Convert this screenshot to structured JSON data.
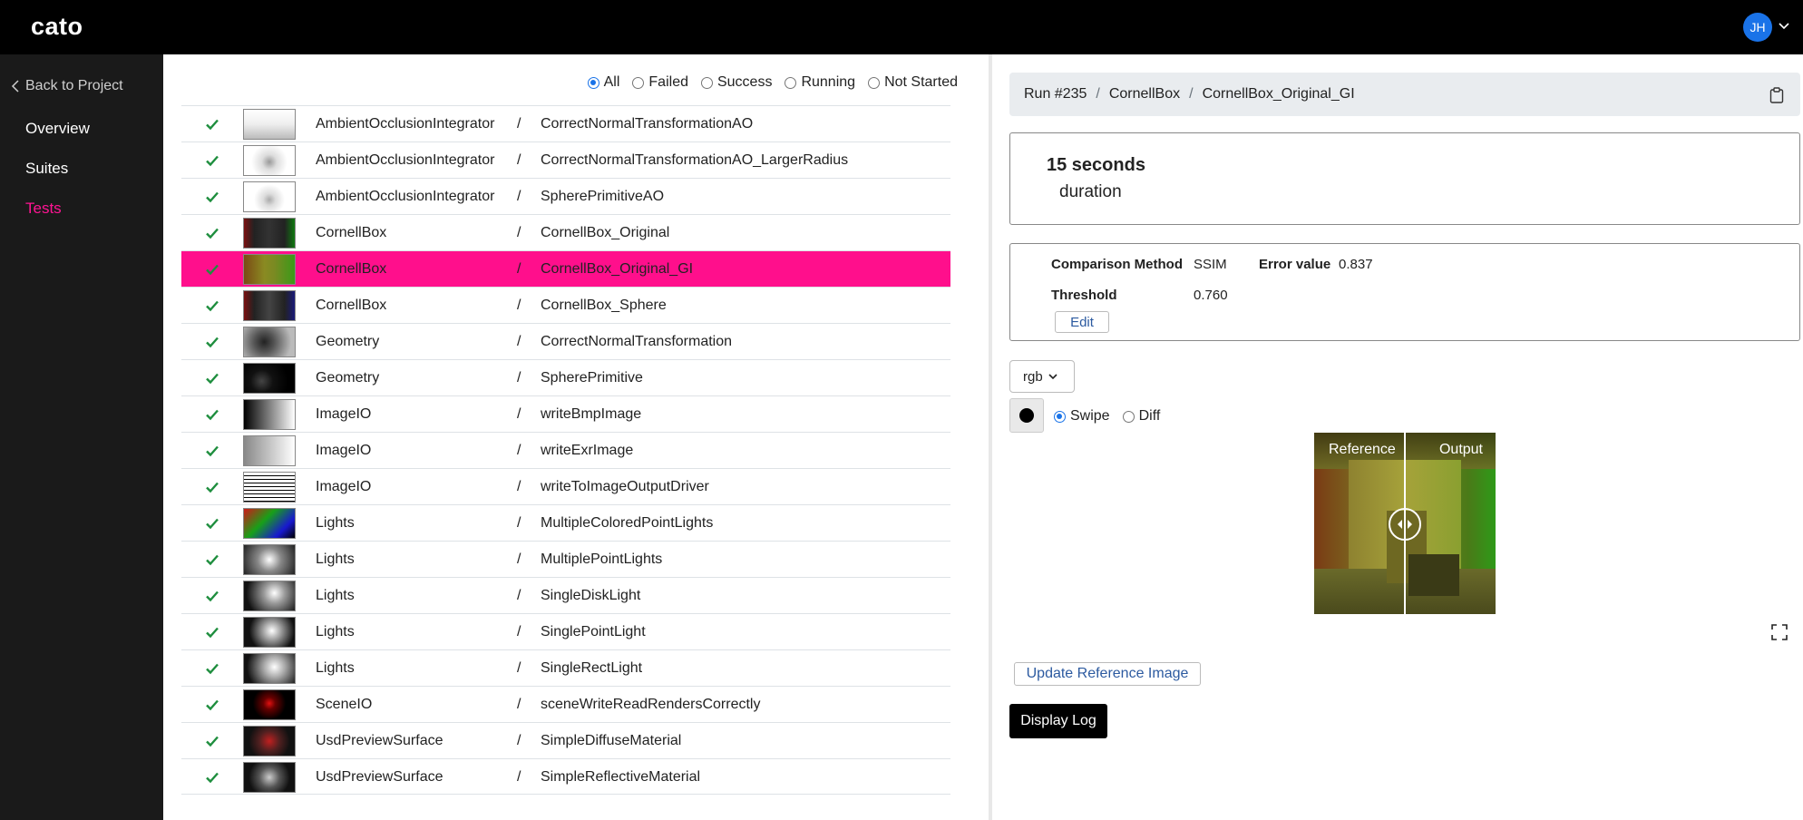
{
  "app": {
    "logo": "cato",
    "user_initials": "JH"
  },
  "sidebar": {
    "back_label": "Back to Project",
    "items": [
      {
        "label": "Overview",
        "active": false
      },
      {
        "label": "Suites",
        "active": false
      },
      {
        "label": "Tests",
        "active": true
      }
    ]
  },
  "filters": {
    "options": [
      "All",
      "Failed",
      "Success",
      "Running",
      "Not Started"
    ],
    "selected": "All"
  },
  "tests": [
    {
      "suite": "AmbientOcclusionIntegrator",
      "name": "CorrectNormalTransformationAO",
      "status": "success",
      "thumb": "ao1"
    },
    {
      "suite": "AmbientOcclusionIntegrator",
      "name": "CorrectNormalTransformationAO_LargerRadius",
      "status": "success",
      "thumb": "ao2"
    },
    {
      "suite": "AmbientOcclusionIntegrator",
      "name": "SpherePrimitiveAO",
      "status": "success",
      "thumb": "ao3"
    },
    {
      "suite": "CornellBox",
      "name": "CornellBox_Original",
      "status": "success",
      "thumb": "cb1"
    },
    {
      "suite": "CornellBox",
      "name": "CornellBox_Original_GI",
      "status": "success",
      "thumb": "cb2",
      "selected": true
    },
    {
      "suite": "CornellBox",
      "name": "CornellBox_Sphere",
      "status": "success",
      "thumb": "cb3"
    },
    {
      "suite": "Geometry",
      "name": "CorrectNormalTransformation",
      "status": "success",
      "thumb": "geo1"
    },
    {
      "suite": "Geometry",
      "name": "SpherePrimitive",
      "status": "success",
      "thumb": "geo2"
    },
    {
      "suite": "ImageIO",
      "name": "writeBmpImage",
      "status": "success",
      "thumb": "grad"
    },
    {
      "suite": "ImageIO",
      "name": "writeExrImage",
      "status": "success",
      "thumb": "grad2"
    },
    {
      "suite": "ImageIO",
      "name": "writeToImageOutputDriver",
      "status": "success",
      "thumb": "grid"
    },
    {
      "suite": "Lights",
      "name": "MultipleColoredPointLights",
      "status": "success",
      "thumb": "color"
    },
    {
      "suite": "Lights",
      "name": "MultiplePointLights",
      "status": "success",
      "thumb": "l1"
    },
    {
      "suite": "Lights",
      "name": "SingleDiskLight",
      "status": "success",
      "thumb": "l2"
    },
    {
      "suite": "Lights",
      "name": "SinglePointLight",
      "status": "success",
      "thumb": "l3"
    },
    {
      "suite": "Lights",
      "name": "SingleRectLight",
      "status": "success",
      "thumb": "l4"
    },
    {
      "suite": "SceneIO",
      "name": "sceneWriteReadRendersCorrectly",
      "status": "success",
      "thumb": "scene"
    },
    {
      "suite": "UsdPreviewSurface",
      "name": "SimpleDiffuseMaterial",
      "status": "success",
      "thumb": "usd1"
    },
    {
      "suite": "UsdPreviewSurface",
      "name": "SimpleReflectiveMaterial",
      "status": "success",
      "thumb": "usd2"
    }
  ],
  "detail": {
    "breadcrumb": [
      "Run #235",
      "CornellBox",
      "CornellBox_Original_GI"
    ],
    "duration_value": "15 seconds",
    "duration_label": "duration",
    "comparison": {
      "method_label": "Comparison Method",
      "method_value": "SSIM",
      "error_label": "Error value",
      "error_value": "0.837",
      "threshold_label": "Threshold",
      "threshold_value": "0.760",
      "edit_label": "Edit"
    },
    "channel": "rgb",
    "view_modes": [
      "Swipe",
      "Diff"
    ],
    "view_mode_selected": "Swipe",
    "viewer_labels": {
      "left": "Reference",
      "right": "Output"
    },
    "update_reference_label": "Update Reference Image",
    "display_log_label": "Display Log"
  },
  "colors": {
    "accent": "#ff0f8c",
    "success": "#1e8e3e",
    "link": "#2c5aa0",
    "avatar": "#1a73e8"
  }
}
